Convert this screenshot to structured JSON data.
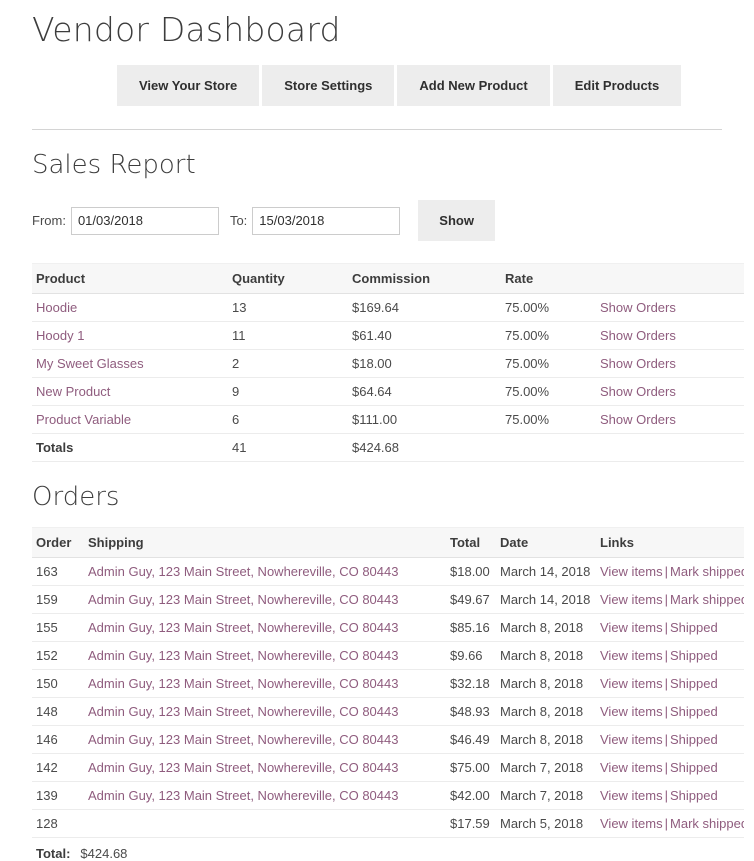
{
  "page": {
    "title": "Vendor Dashboard"
  },
  "nav": {
    "buttons": [
      {
        "label": "View Your Store",
        "name": "view-your-store-button"
      },
      {
        "label": "Store Settings",
        "name": "store-settings-button"
      },
      {
        "label": "Add New Product",
        "name": "add-new-product-button"
      },
      {
        "label": "Edit Products",
        "name": "edit-products-button"
      }
    ]
  },
  "sales_report": {
    "heading": "Sales Report",
    "filter": {
      "from_label": "From:",
      "from_value": "01/03/2018",
      "from_placeholder": "dd/mm/yyyy",
      "to_label": "To:",
      "to_value": "15/03/2018",
      "to_placeholder": "dd/mm/yyyy",
      "show_label": "Show"
    },
    "columns": [
      "Product",
      "Quantity",
      "Commission",
      "Rate",
      ""
    ],
    "rows": [
      {
        "product": "Hoodie",
        "quantity": "13",
        "commission": "$169.64",
        "rate": "75.00%",
        "action": "Show Orders"
      },
      {
        "product": "Hoody 1",
        "quantity": "11",
        "commission": "$61.40",
        "rate": "75.00%",
        "action": "Show Orders"
      },
      {
        "product": "My Sweet Glasses",
        "quantity": "2",
        "commission": "$18.00",
        "rate": "75.00%",
        "action": "Show Orders"
      },
      {
        "product": "New Product",
        "quantity": "9",
        "commission": "$64.64",
        "rate": "75.00%",
        "action": "Show Orders"
      },
      {
        "product": "Product Variable",
        "quantity": "6",
        "commission": "$111.00",
        "rate": "75.00%",
        "action": "Show Orders"
      }
    ],
    "totals": {
      "product": "Totals",
      "quantity": "41",
      "commission": "$424.68",
      "rate": "",
      "action": ""
    }
  },
  "orders": {
    "heading": "Orders",
    "columns": [
      "Order",
      "Shipping",
      "Total",
      "Date",
      "Links"
    ],
    "rows": [
      {
        "order": "163",
        "shipping": "Admin Guy, 123 Main Street, Nowhereville, CO 80443",
        "total": "$18.00",
        "date": "March 14, 2018",
        "link1": "View items",
        "sep": "|",
        "link2": "Mark shipped"
      },
      {
        "order": "159",
        "shipping": "Admin Guy, 123 Main Street, Nowhereville, CO 80443",
        "total": "$49.67",
        "date": "March 14, 2018",
        "link1": "View items",
        "sep": "|",
        "link2": "Mark shipped"
      },
      {
        "order": "155",
        "shipping": "Admin Guy, 123 Main Street, Nowhereville, CO 80443",
        "total": "$85.16",
        "date": "March 8, 2018",
        "link1": "View items",
        "sep": "|",
        "link2": "Shipped"
      },
      {
        "order": "152",
        "shipping": "Admin Guy, 123 Main Street, Nowhereville, CO 80443",
        "total": "$9.66",
        "date": "March 8, 2018",
        "link1": "View items",
        "sep": "|",
        "link2": "Shipped"
      },
      {
        "order": "150",
        "shipping": "Admin Guy, 123 Main Street, Nowhereville, CO 80443",
        "total": "$32.18",
        "date": "March 8, 2018",
        "link1": "View items",
        "sep": "|",
        "link2": "Shipped"
      },
      {
        "order": "148",
        "shipping": "Admin Guy, 123 Main Street, Nowhereville, CO 80443",
        "total": "$48.93",
        "date": "March 8, 2018",
        "link1": "View items",
        "sep": "|",
        "link2": "Shipped"
      },
      {
        "order": "146",
        "shipping": "Admin Guy, 123 Main Street, Nowhereville, CO 80443",
        "total": "$46.49",
        "date": "March 8, 2018",
        "link1": "View items",
        "sep": "|",
        "link2": "Shipped"
      },
      {
        "order": "142",
        "shipping": "Admin Guy, 123 Main Street, Nowhereville, CO 80443",
        "total": "$75.00",
        "date": "March 7, 2018",
        "link1": "View items",
        "sep": "|",
        "link2": "Shipped"
      },
      {
        "order": "139",
        "shipping": "Admin Guy, 123 Main Street, Nowhereville, CO 80443",
        "total": "$42.00",
        "date": "March 7, 2018",
        "link1": "View items",
        "sep": "|",
        "link2": "Shipped"
      },
      {
        "order": "128",
        "shipping": "",
        "total": "$17.59",
        "date": "March 5, 2018",
        "link1": "View items",
        "sep": "|",
        "link2": "Mark shipped"
      }
    ],
    "total_label": "Total:",
    "total_value": "$424.68"
  },
  "colors": {
    "link": "#8f5c7e",
    "heading": "#3d3d3d",
    "button_bg": "#ededed",
    "table_header_bg": "#f7f7f7",
    "border": "#ececec"
  }
}
